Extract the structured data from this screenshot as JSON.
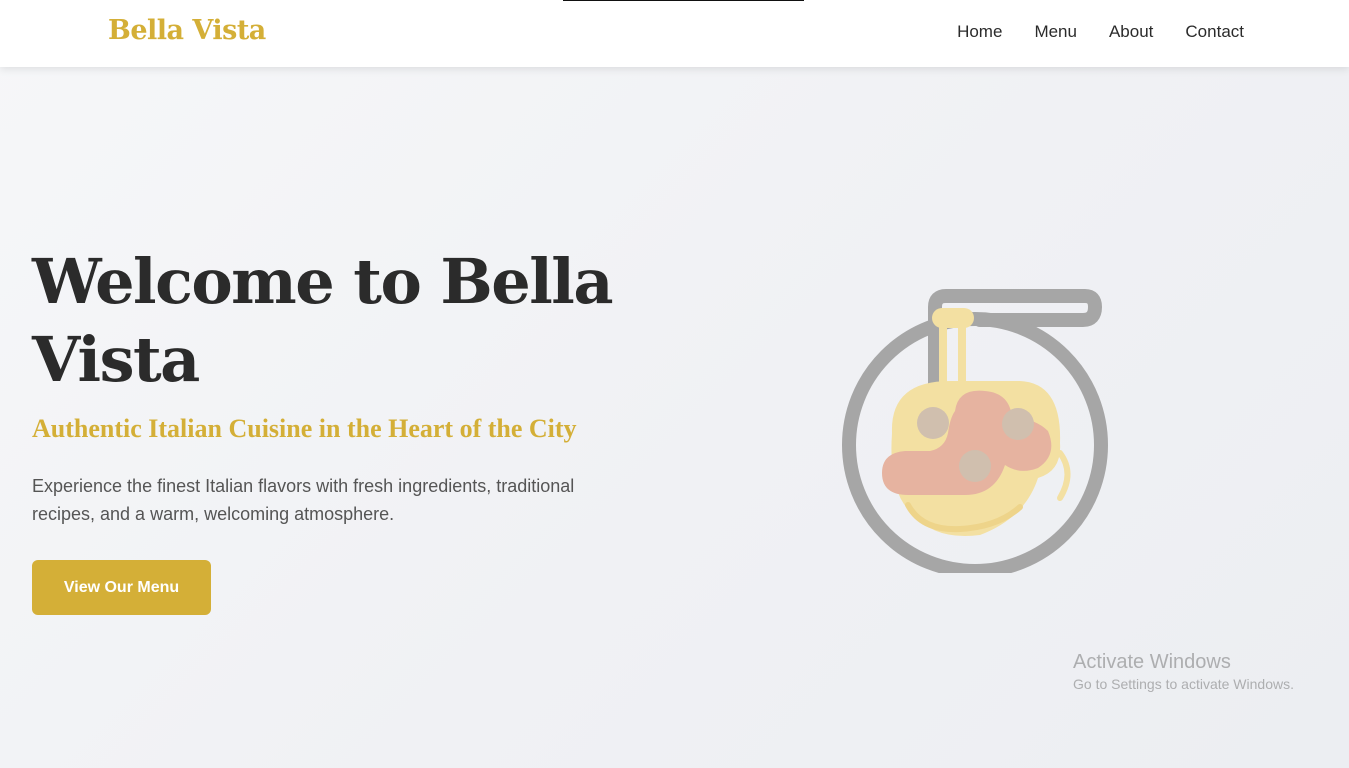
{
  "header": {
    "logo": "Bella Vista",
    "nav": [
      {
        "label": "Home"
      },
      {
        "label": "Menu"
      },
      {
        "label": "About"
      },
      {
        "label": "Contact"
      }
    ]
  },
  "hero": {
    "title": "Welcome to Bella Vista",
    "subtitle": "Authentic Italian Cuisine in the Heart of the City",
    "description": "Experience the finest Italian flavors with fresh ingredients, traditional recipes, and a warm, welcoming atmosphere.",
    "cta_label": "View Our Menu",
    "illustration_icon": "spaghetti-bowl-icon"
  },
  "watermark": {
    "title": "Activate Windows",
    "subtitle": "Go to Settings to activate Windows."
  },
  "colors": {
    "accent": "#d4af37",
    "text": "#2b2b2b",
    "muted_text": "#555555",
    "background": "#f2f3f6"
  }
}
